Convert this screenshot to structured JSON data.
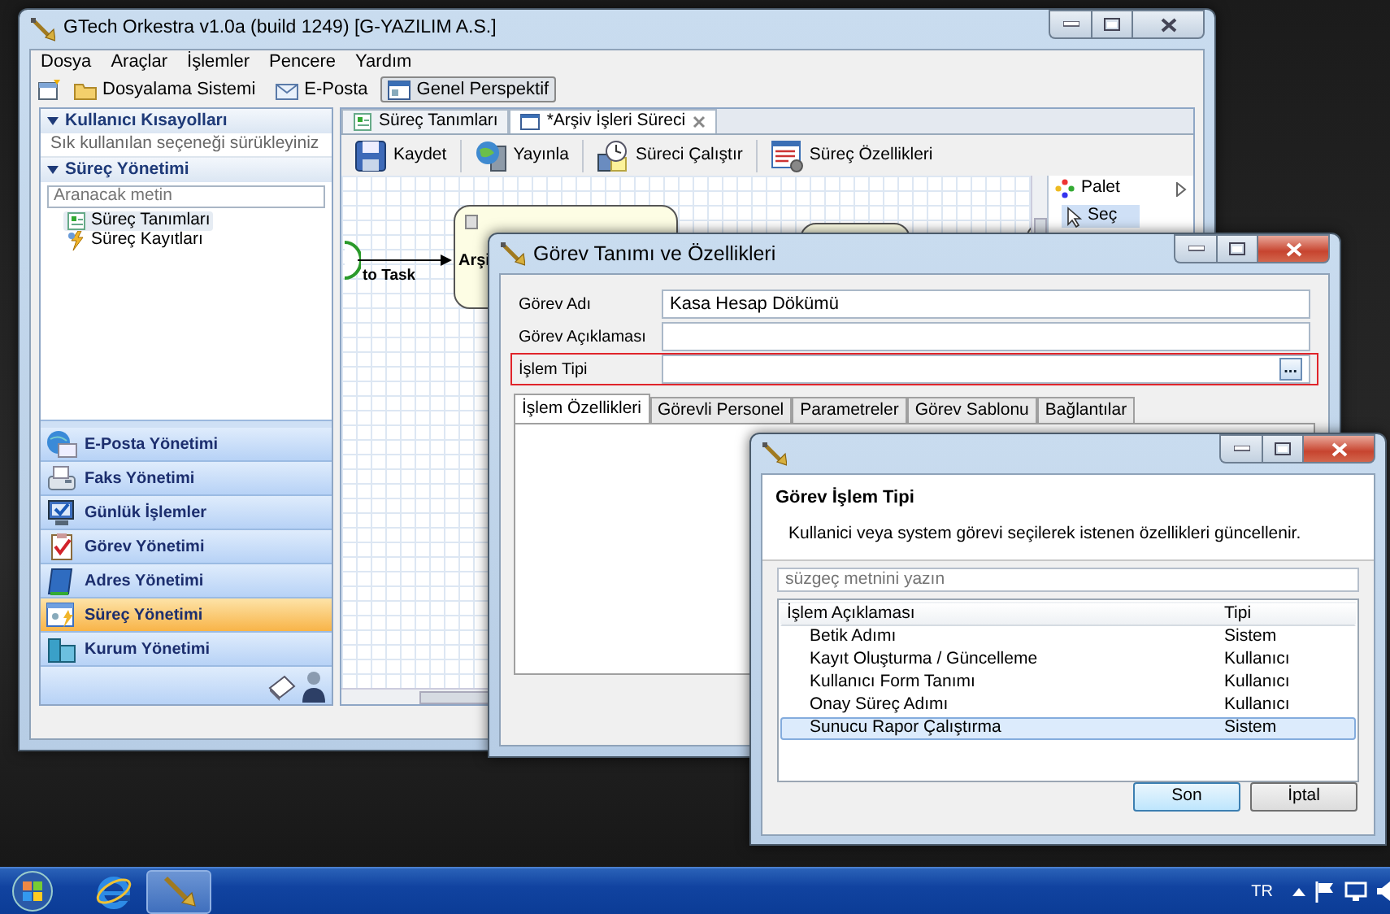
{
  "main_window": {
    "title": "GTech Orkestra v1.0a (build 1249) [G-YAZILIM A.S.]",
    "menu": [
      "Dosya",
      "Araçlar",
      "İşlemler",
      "Pencere",
      "Yardım"
    ],
    "toolbar": [
      {
        "label": "Dosyalama Sistemi",
        "selected": false
      },
      {
        "label": "E-Posta",
        "selected": false
      },
      {
        "label": "Genel Perspektif",
        "selected": true
      }
    ],
    "sidebar": {
      "shortcuts": {
        "title": "Kullanıcı Kısayolları",
        "expanded": true,
        "hint": "Sık kullanılan seçeneği sürükleyiniz"
      },
      "process": {
        "title": "Süreç Yönetimi",
        "expanded": true,
        "search": {
          "placeholder": "Aranacak metin"
        },
        "items": [
          {
            "label": "Süreç Tanımları",
            "selected": true
          },
          {
            "label": "Süreç Kayıtları",
            "selected": false
          }
        ]
      },
      "modules": [
        {
          "label": "E-Posta Yönetimi",
          "selected": false
        },
        {
          "label": "Faks Yönetimi",
          "selected": false
        },
        {
          "label": "Günlük İşlemler",
          "selected": false
        },
        {
          "label": "Görev Yönetimi",
          "selected": false
        },
        {
          "label": "Adres Yönetimi",
          "selected": false
        },
        {
          "label": "Süreç Yönetimi",
          "selected": true
        },
        {
          "label": "Kurum Yönetimi",
          "selected": false
        }
      ]
    },
    "editor_tabs": [
      {
        "label": "Süreç Tanımları",
        "selected": false,
        "closable": false
      },
      {
        "label": "*Arşiv İşleri Süreci",
        "selected": true,
        "closable": true
      }
    ],
    "editor_toolbar": [
      "Kaydet",
      "Yayınla",
      "Süreci Çalıştır",
      "Süreç Özellikleri"
    ],
    "canvas": {
      "node_label": "Arşi",
      "edge_label": "to Task"
    },
    "palette": {
      "title": "Palet",
      "tools": [
        {
          "label": "Seç",
          "selected": true
        }
      ]
    }
  },
  "task_dialog": {
    "title": "Görev Tanımı ve Özellikleri",
    "fields": [
      {
        "label": "Görev Adı",
        "value": "Kasa Hesap Dökümü",
        "highlighted": false
      },
      {
        "label": "Görev Açıklaması",
        "highlighted": false
      },
      {
        "label": "İşlem Tipi",
        "highlighted": true,
        "browse": "..."
      }
    ],
    "tabs": [
      {
        "label": "İşlem Özellikleri",
        "selected": true
      },
      {
        "label": "Görevli Personel",
        "selected": false
      },
      {
        "label": "Parametreler",
        "selected": false
      },
      {
        "label": "Görev Sablonu",
        "selected": false
      },
      {
        "label": "Bağlantılar",
        "selected": false
      }
    ]
  },
  "type_dialog": {
    "heading": "Görev İşlem Tipi",
    "description": "Kullanici veya system görevi seçilerek istenen özellikleri güncellenir.",
    "filter": {
      "placeholder": "süzgeç metnini yazın"
    },
    "table": {
      "columns": [
        "İşlem Açıklaması",
        "Tipi"
      ],
      "rows": [
        {
          "cells": [
            "Betik Adımı",
            "Sistem"
          ],
          "selected": false
        },
        {
          "cells": [
            "Kayıt Oluşturma / Güncelleme",
            "Kullanıcı"
          ],
          "selected": false
        },
        {
          "cells": [
            "Kullanıcı Form Tanımı",
            "Kullanıcı"
          ],
          "selected": false
        },
        {
          "cells": [
            "Onay Süreç Adımı",
            "Kullanıcı"
          ],
          "selected": false
        },
        {
          "cells": [
            "Sunucu Rapor Çalıştırma",
            "Sistem"
          ],
          "selected": true
        }
      ]
    },
    "buttons": [
      {
        "label": "Son",
        "default": true
      },
      {
        "label": "İptal",
        "default": false
      }
    ]
  },
  "taskbar": {
    "language": "TR"
  }
}
